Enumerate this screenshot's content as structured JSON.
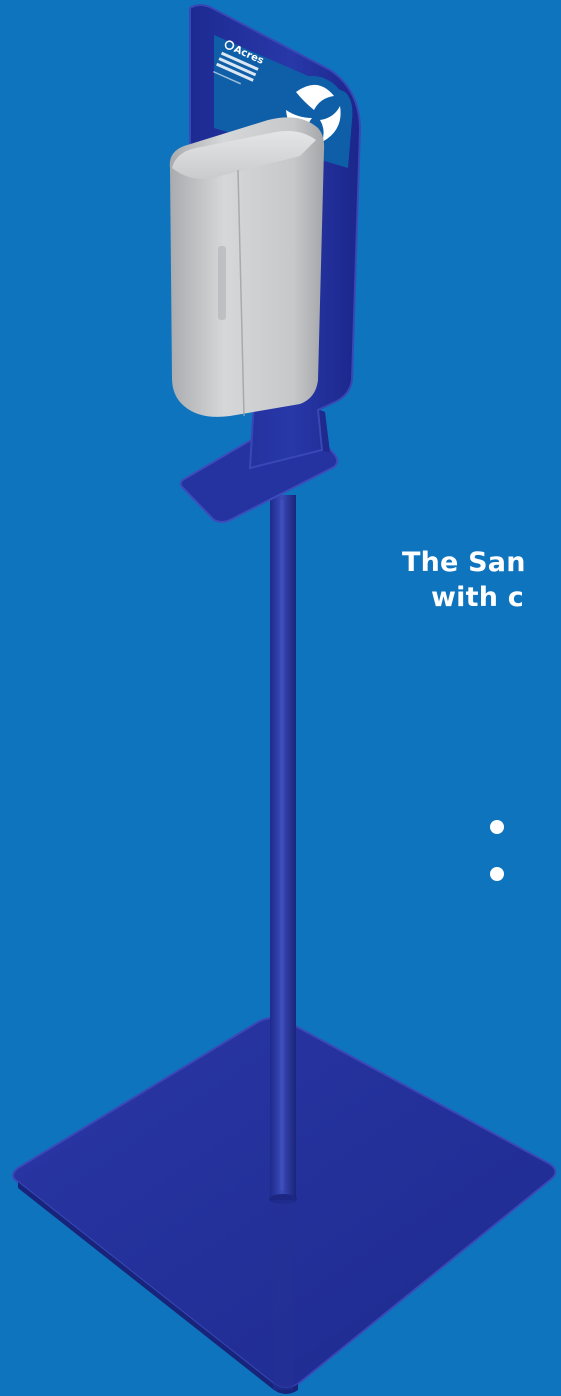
{
  "headline": {
    "line_1": "The San",
    "line_2": "with c"
  },
  "bullets": [
    {
      "text": ""
    },
    {
      "text": ""
    }
  ],
  "product": {
    "brand_text": "Acres",
    "stand_color": "#232f9c",
    "dispenser_color": "#cfd1d3",
    "background_color": "#0f74be"
  }
}
